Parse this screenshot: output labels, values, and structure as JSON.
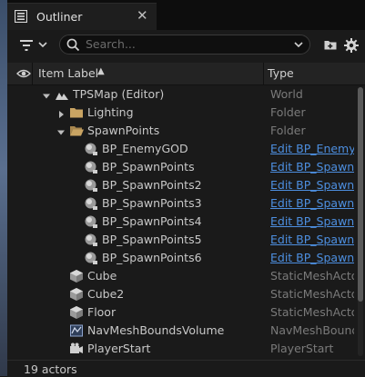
{
  "tab": {
    "title": "Outliner",
    "close": "✕"
  },
  "search": {
    "placeholder": "Search..."
  },
  "header": {
    "label": "Item Label",
    "sort": "▲",
    "type": "Type"
  },
  "rows": [
    {
      "label": "TPSMap (Editor)",
      "type": "World",
      "icon": "map-icon",
      "expanded": true,
      "indent": 0
    },
    {
      "label": "Lighting",
      "type": "Folder",
      "icon": "folder-icon",
      "expanded": false,
      "indent": 1
    },
    {
      "label": "SpawnPoints",
      "type": "Folder",
      "icon": "folder-open-icon",
      "expanded": true,
      "indent": 1
    },
    {
      "label": "BP_EnemyGOD",
      "type": "Edit BP_EnemyGOD",
      "icon": "blueprint-actor-icon",
      "indent": 2,
      "link": true
    },
    {
      "label": "BP_SpawnPoints",
      "type": "Edit BP_SpawnPoints",
      "icon": "blueprint-actor-icon",
      "indent": 2,
      "link": true
    },
    {
      "label": "BP_SpawnPoints2",
      "type": "Edit BP_SpawnPoints",
      "icon": "blueprint-actor-icon",
      "indent": 2,
      "link": true
    },
    {
      "label": "BP_SpawnPoints3",
      "type": "Edit BP_SpawnPoints",
      "icon": "blueprint-actor-icon",
      "indent": 2,
      "link": true
    },
    {
      "label": "BP_SpawnPoints4",
      "type": "Edit BP_SpawnPoints",
      "icon": "blueprint-actor-icon",
      "indent": 2,
      "link": true
    },
    {
      "label": "BP_SpawnPoints5",
      "type": "Edit BP_SpawnPoints",
      "icon": "blueprint-actor-icon",
      "indent": 2,
      "link": true
    },
    {
      "label": "BP_SpawnPoints6",
      "type": "Edit BP_SpawnPoints",
      "icon": "blueprint-actor-icon",
      "indent": 2,
      "link": true
    },
    {
      "label": "Cube",
      "type": "StaticMeshActor",
      "icon": "static-mesh-icon",
      "indent": 1
    },
    {
      "label": "Cube2",
      "type": "StaticMeshActor",
      "icon": "static-mesh-icon",
      "indent": 1
    },
    {
      "label": "Floor",
      "type": "StaticMeshActor",
      "icon": "static-mesh-icon",
      "indent": 1
    },
    {
      "label": "NavMeshBoundsVolume",
      "type": "NavMeshBoundsVolume",
      "icon": "nav-volume-icon",
      "indent": 1
    },
    {
      "label": "PlayerStart",
      "type": "PlayerStart",
      "icon": "player-start-icon",
      "indent": 1
    }
  ],
  "status": {
    "count": "19 actors"
  },
  "colors": {
    "link": "#4d8fe0",
    "folder": "#c9a463",
    "type_text": "#7a7a7a"
  }
}
